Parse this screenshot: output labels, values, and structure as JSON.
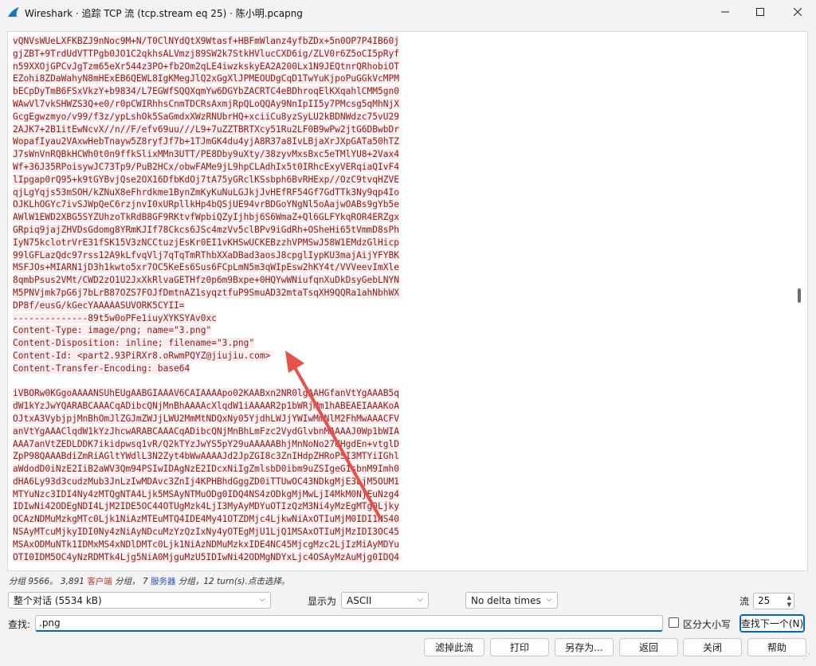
{
  "window": {
    "title": "Wireshark · 追踪 TCP 流 (tcp.stream eq 25) · 陈小明.pcapng"
  },
  "stream": {
    "lines": [
      {
        "text": "vQNVsWUeLXFKBZJ9nNoc9M+N/T0ClNYdQtX9Wtasf+HBFmWlanz4yfbZDx+5n0OP7P4IB60j",
        "kind": "client"
      },
      {
        "text": "gjZBT+9TrdUdVTTPgb0JO1C2qkhsALVmzj89SW2k7StkHVlucCXD6ig/ZLV0r6Z5oCI5pRyf",
        "kind": "client"
      },
      {
        "text": "n59XXOjGPCvJgTzm65eXr544z3PO+fb2Om2qLE4iwzkskyEA2A200Lx1N9JEQtnrQRhobiOT",
        "kind": "client"
      },
      {
        "text": "EZohi8ZDaWahyN8mHExEB6QEWL8IgKMegJlQ2xGgXlJPMEOUDgCqD1TwYuKjpoPuGGkVcMPM",
        "kind": "client"
      },
      {
        "text": "bECpDyTmB6FSxVkzY+b9834/L7EGWfSQQXqmYw6DGYbZACRTC4eBDhroqElKXqahlCMM5gn0",
        "kind": "client"
      },
      {
        "text": "WAwVl7vkSHWZS3Q+e0/r0pCWIRhhsCnmTDCRsAxmjRpQLoQQAy9NnIpII5y7PMcsg5qMhNjX",
        "kind": "client"
      },
      {
        "text": "GcgEgwzmyo/v99/f3z/ypLshOk5SaGmdxXWzRNUbrHQ+xciiCu8yzSyLU2kBDNWdzc75vU29",
        "kind": "client"
      },
      {
        "text": "2AJK7+2B1itEwNcvX//n//F/efv69uu///L9+7uZZTBRTXcy51Ru2LF0B9wPw2jtG6DBwbDr",
        "kind": "client"
      },
      {
        "text": "WopafIyau2VAxwHebTnayw5Z8ryfJf7b+1TJmGK4du4yjA8R37a8IvLBjaXrJXpGATa50hTZ",
        "kind": "client"
      },
      {
        "text": "J7sWnVnRQBkHCWh0t0n9ffkSlixMMn3UTT/PE8Dby9uXty/38zyvMxsBxc5eTMlYU8+2Vax4",
        "kind": "client"
      },
      {
        "text": "Wf+36J35RPoisywJC73Tp9/PuB2HCx/obwFAMe9jL9hpCLAdhIx5t0IRhcExyVERqiaQIvF4",
        "kind": "client"
      },
      {
        "text": "lIpgap0rQ95+k9tGYBvjQse2OX16DfbKdOj7tA75yGRclKSsbph6BvRHExp//OzC9tvqHZVE",
        "kind": "client"
      },
      {
        "text": "qjLgYqjs53mSOH/kZNuX8eFhrdkme1BynZmKyKuNuLGJkjJvHEfRF54Gf7GdTTk3Ny9qp4Io",
        "kind": "client"
      },
      {
        "text": "OJKLhOGYc7ivSJWpQeC6rzjnvI0xURpllkHp4bQSjUE94vrBDGoYNgNl5oAajwOABs9gYb5e",
        "kind": "client"
      },
      {
        "text": "AWlW1EWD2XBG5SYZUhzoTkRdB8GF9RKtvfWpbiQZyIjhbj6S6WmaZ+Ql6GLFYkqROR4ERZgx",
        "kind": "client"
      },
      {
        "text": "GRpiq9jajZHVDsGdomg8YRmKJIf78Ckcs6JSc4mzVv5clBPv9iGdRh+OSheHi65tVmmD8sPh",
        "kind": "client"
      },
      {
        "text": "IyN75kclotrVrE31fSK15V3zNCCtuzjEsKr0EI1vKHSwUCKEBzzhVPMSwJ58W1EMdzGlHicp",
        "kind": "client"
      },
      {
        "text": "99lGFLazQdc97rss12A9kLfvqVlj7qTqTmRThbXXaDBad3aosJ8cpglIypKU3majAijYFYBK",
        "kind": "client"
      },
      {
        "text": "MSFJOs+MIARN1jD3h1kwto5xr7OC5KeEs6Sus6FCpLmN5m3qWIpEsw2hKY4t/VVVeevImXle",
        "kind": "client"
      },
      {
        "text": "8qmbPsus2VMt/CWD2zO1U2JxXkRlvaGETHfz0p6m9Bxpe+0HQYwWNiufqnXuDkDsyGebLNYN",
        "kind": "client"
      },
      {
        "text": "M5PNVjmk7pG6j7bLrB87OZS7FOJfDmtnAZ1syqztfuP9SmuAD32mtaTsqXH9QQRa1ahNbhWX",
        "kind": "client"
      },
      {
        "text": "DP8f/eusG/kGecYAAAAASUVORK5CYII=",
        "kind": "client"
      },
      {
        "text": "--------------89t5w0oPFe1iuyXYKSYAv0xc",
        "kind": "client"
      },
      {
        "text": "Content-Type: image/png; name=\"3.png\"",
        "kind": "client"
      },
      {
        "text": "Content-Disposition: inline; filename=\"3.png\"",
        "kind": "client"
      },
      {
        "text": "Content-Id: <part2.93PiRXr8.oRwmPQYZ@jiujiu.com>",
        "kind": "client"
      },
      {
        "text": "Content-Transfer-Encoding: base64",
        "kind": "client"
      },
      {
        "text": "",
        "kind": "blank"
      },
      {
        "text": "iVBORw0KGgoAAAANSUhEUgAABGIAAAV6CAIAAAApo02KAABxn2NR0lgAAHGfanVtYgAAAB5q",
        "kind": "client"
      },
      {
        "text": "dW1kYzJwYQARABCAAACqADibcQNjMnBhAAAAcXlqdW1iAAAAR2p1bWRjMm1hABEAEIAAAKoA",
        "kind": "client"
      },
      {
        "text": "OJtxA3VybjpjMnBhOmJlZGJmZWJjLWU2MmMtNDQxNy05YjdhLWJjYWIwMmNlM2FhMwAAACFV",
        "kind": "client"
      },
      {
        "text": "anVtYgAAAClqdW1kYzJhcwARABCAAACqADibcQNjMnBhLmFzc2VydGlvbnMAAAAJ0Wp1bWIA",
        "kind": "client"
      },
      {
        "text": "AAA7anVtZEDLDDK7ikidpwsq1vR/Q2kTYzJwYS5pY29uAAAAABhjMnNoNo27dHgdEn+vtglD",
        "kind": "client"
      },
      {
        "text": "ZpP98QAAABdiZmRiAGltYWdlL3N2Zyt4bWwAAAAJd2JpZGI8c3ZnIHdpZHRoPSI3MTYiIGhl",
        "kind": "client"
      },
      {
        "text": "aWdodD0iNzE2IiB2aWV3Qm94PSIwIDAgNzE2IDcxNiIgZmlsbD0ibm9uZSIgeG1sbnM9Imh0",
        "kind": "client"
      },
      {
        "text": "dHA6Ly93d3cudzMub3JnLzIwMDAvc3ZnIj4KPHBhdGggZD0iTTUwOC43NDkgMjE3LjM5OUM1",
        "kind": "client"
      },
      {
        "text": "MTYuNzc3IDI4Ny4zMTQgNTA4Ljk5MSAyNTMuODg0IDQ4NS4zODkgMjMwLjI4MkM0NjEuNzg4",
        "kind": "client"
      },
      {
        "text": "IDIwNi42ODEgNDI4LjM2IDE5OC44OTUgMzk4LjI3MyAyMDYuOTIzQzM3Ni4yMzEgMTg0Ljky",
        "kind": "client"
      },
      {
        "text": "OCAzNDMuMzkgMTc0Ljk1NiAzMTEuMTQ4IDE4My41OTZDMjc4LjkwNiAxOTIuMjM0IDI1NS40",
        "kind": "client"
      },
      {
        "text": "NSAyMTcuMjkyIDI0Ny4zNiAyNDcuMzYzQzIxNy4yOTEgMjU1LjQ1MSAxOTIuMjMzIDI3OC45",
        "kind": "client"
      },
      {
        "text": "MSAxODMuNTk1IDMxMS4xNDlDMTc0Ljk1NiAzNDMuMzkxIDE4NC45MjcgMzc2LjIzMiAyMDYu",
        "kind": "client"
      },
      {
        "text": "OTI0IDM5OC4yNzRDMTk4Ljg5NiA0MjguMzU5IDIwNi42ODMgNDYxLjc4OSAyMzAuMjg0IDQ4",
        "kind": "client"
      }
    ]
  },
  "status": {
    "prefix": "分组 9566。",
    "client_count": "3,891",
    "client_label": "客户端",
    "mid": "分组，",
    "server_count": "7",
    "server_label": "服务器",
    "suffix": "分组，12 turn(s).点击选择。"
  },
  "controls": {
    "conversation_select": "整个对话 (5534 kB)",
    "show_as_label": "显示为",
    "show_as_value": "ASCII",
    "delta_select": "No delta times",
    "stream_label": "流",
    "stream_value": "25",
    "search_label": "查找:",
    "search_value": ".png",
    "case_label": "区分大小写",
    "find_next_label": "查找下一个(N)"
  },
  "buttons": {
    "filter_out": "滤掉此流",
    "print": "打印",
    "save_as": "另存为...",
    "back": "返回",
    "close": "关闭",
    "help": "帮助"
  },
  "colors": {
    "client_text": "#8a1a1a",
    "client_bg": "#fbeded",
    "arrow": "#e8504a",
    "accent": "#0067c0"
  },
  "icons": [
    "wireshark-fin-icon",
    "minimize-icon",
    "maximize-icon",
    "close-icon",
    "chevron-down-icon",
    "spin-arrows-icon",
    "resize-grip-icon"
  ]
}
